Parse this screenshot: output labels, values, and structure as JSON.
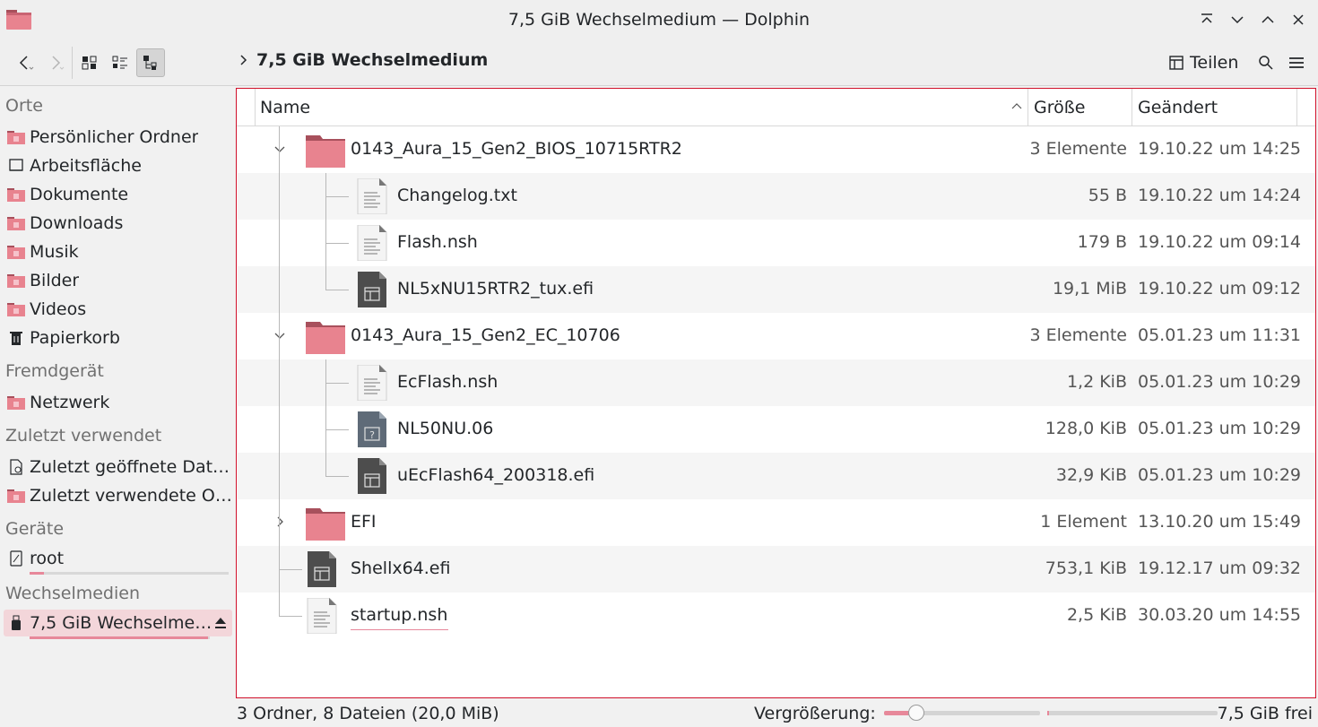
{
  "window": {
    "title": "7,5 GiB Wechselmedium — Dolphin",
    "buttons": [
      "keep-above",
      "minimize",
      "maximize",
      "close"
    ]
  },
  "toolbar": {
    "breadcrumb": "7,5 GiB Wechselmedium",
    "share_label": "Teilen",
    "view_mode": "details"
  },
  "sidebar": {
    "sections": {
      "places": "Orte",
      "remote": "Fremdgerät",
      "recent": "Zuletzt verwendet",
      "devices": "Geräte",
      "removable": "Wechselmedien"
    },
    "places": [
      {
        "label": "Persönlicher Ordner",
        "icon": "home-folder-icon"
      },
      {
        "label": "Arbeitsfläche",
        "icon": "desktop-icon"
      },
      {
        "label": "Dokumente",
        "icon": "documents-folder-icon"
      },
      {
        "label": "Downloads",
        "icon": "downloads-folder-icon"
      },
      {
        "label": "Musik",
        "icon": "music-folder-icon"
      },
      {
        "label": "Bilder",
        "icon": "pictures-folder-icon"
      },
      {
        "label": "Videos",
        "icon": "videos-folder-icon"
      },
      {
        "label": "Papierkorb",
        "icon": "trash-icon"
      }
    ],
    "remote": [
      {
        "label": "Netzwerk",
        "icon": "network-folder-icon"
      }
    ],
    "recent": [
      {
        "label": "Zuletzt geöffnete Dat…",
        "icon": "recent-files-icon"
      },
      {
        "label": "Zuletzt verwendete O…",
        "icon": "recent-folders-icon"
      }
    ],
    "devices": [
      {
        "label": "root",
        "icon": "drive-icon",
        "usage": 0.07
      }
    ],
    "removable": [
      {
        "label": "7,5 GiB Wechselme…",
        "icon": "usb-drive-icon",
        "usage": 0.99,
        "active": true
      }
    ]
  },
  "columns": {
    "name": "Name",
    "size": "Größe",
    "modified": "Geändert"
  },
  "files": [
    {
      "name": "0143_Aura_15_Gen2_BIOS_10715RTR2",
      "type": "folder",
      "size": "3 Elemente",
      "date": "19.10.22 um 14:25",
      "depth": 0,
      "expanded": true
    },
    {
      "name": "Changelog.txt",
      "type": "text",
      "size": "55 B",
      "date": "19.10.22 um 14:24",
      "depth": 1
    },
    {
      "name": "Flash.nsh",
      "type": "text",
      "size": "179 B",
      "date": "19.10.22 um 09:14",
      "depth": 1
    },
    {
      "name": "NL5xNU15RTR2_tux.efi",
      "type": "exec",
      "size": "19,1 MiB",
      "date": "19.10.22 um 09:12",
      "depth": 1
    },
    {
      "name": "0143_Aura_15_Gen2_EC_10706",
      "type": "folder",
      "size": "3 Elemente",
      "date": "05.01.23 um 11:31",
      "depth": 0,
      "expanded": true
    },
    {
      "name": "EcFlash.nsh",
      "type": "text",
      "size": "1,2 KiB",
      "date": "05.01.23 um 10:29",
      "depth": 1
    },
    {
      "name": "NL50NU.06",
      "type": "unknown",
      "size": "128,0 KiB",
      "date": "05.01.23 um 10:29",
      "depth": 1
    },
    {
      "name": "uEcFlash64_200318.efi",
      "type": "exec",
      "size": "32,9 KiB",
      "date": "05.01.23 um 10:29",
      "depth": 1
    },
    {
      "name": "EFI",
      "type": "folder",
      "size": "1 Element",
      "date": "13.10.20 um 15:49",
      "depth": 0,
      "expanded": false
    },
    {
      "name": "Shellx64.efi",
      "type": "exec",
      "size": "753,1 KiB",
      "date": "19.12.17 um 09:32",
      "depth": 0
    },
    {
      "name": "startup.nsh",
      "type": "text",
      "size": "2,5 KiB",
      "date": "30.03.20 um 14:55",
      "depth": 0
    }
  ],
  "status": {
    "summary": "3 Ordner, 8 Dateien (20,0 MiB)",
    "zoom_label": "Vergrößerung:",
    "zoom_level": 0.22,
    "free_space": "7,5 GiB frei"
  },
  "colors": {
    "accent": "#e7889a",
    "folder": "#e8838f",
    "folder_tab": "#a8505c",
    "selection": "#f3d6da",
    "focus_border": "#d0102a"
  }
}
